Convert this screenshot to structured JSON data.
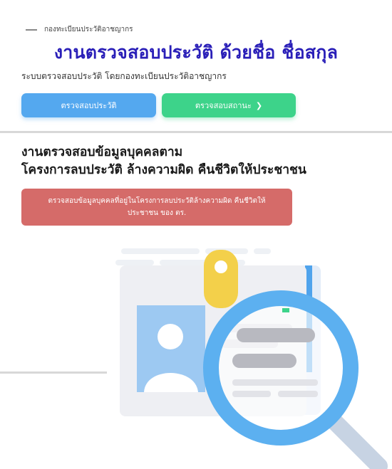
{
  "breadcrumb": {
    "text": "กองทะเบียนประวัติอาชญากร"
  },
  "headline": "งานตรวจสอบประวัติ ด้วยชื่อ ชื่อสกุล",
  "subtitle": "ระบบตรวจสอบประวัติ โดยกองทะเบียนประวัติอาชญากร",
  "buttons": {
    "check_history": "ตรวจสอบประวัติ",
    "check_status": "ตรวจสอบสถานะ"
  },
  "section": {
    "title_line1": "งานตรวจสอบข้อมูลบุคคลตาม",
    "title_line2": "โครงการลบประวัติ ล้างความผิด คืนชีวิตให้ประชาชน"
  },
  "alert": {
    "line1": "ตรวจสอบข้อมูลบุคคลที่อยู่ในโครงการลบประวัติล้างความผิด คืนชีวิตให้",
    "line2": "ประชาชน ของ ตร."
  },
  "icons": {
    "breadcrumb": "dash-icon",
    "status_button": "chevron-right-icon",
    "illustration": "id-card-magnifier-icon"
  },
  "colors": {
    "headline": "#2a1fb8",
    "button_blue": "#54a8ef",
    "button_green": "#3dd38a",
    "alert": "#d56b69"
  }
}
